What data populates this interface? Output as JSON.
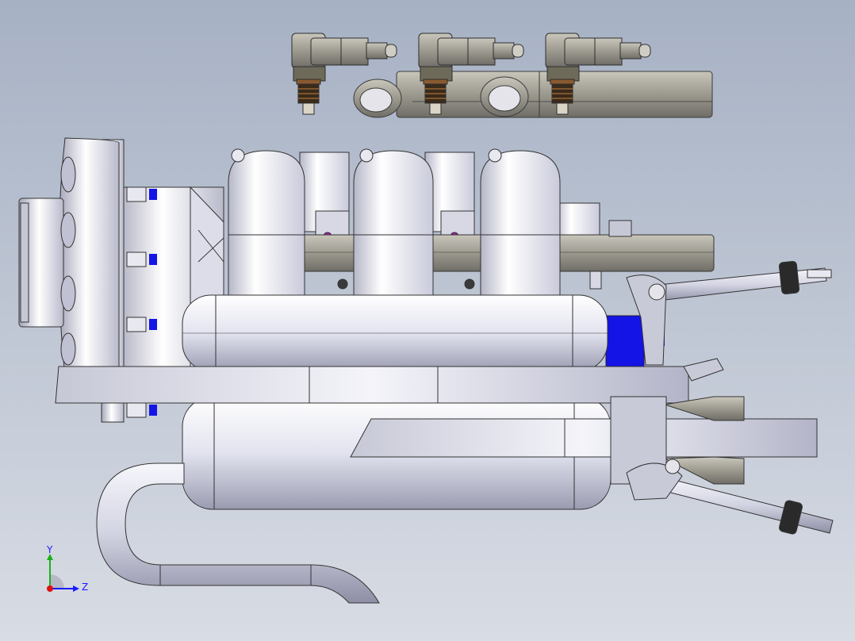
{
  "viewport": {
    "background_top": "#a9b4c6",
    "background_bottom": "#d6dbe4"
  },
  "triad": {
    "y_label": "Y",
    "z_label": "Z",
    "y_color": "#19b219",
    "z_color": "#1a1aff",
    "x_color": "#e01010"
  },
  "model": {
    "parts": [
      "fuel-injector",
      "fuel-rail",
      "intake-runner",
      "plenum",
      "cylinder",
      "exhaust-silencer",
      "exhaust-pipe",
      "mounting-plate",
      "propeller-hub",
      "ignition-lead"
    ],
    "fastener_color": "#1414e6",
    "accent_color": "#b01ab0"
  }
}
